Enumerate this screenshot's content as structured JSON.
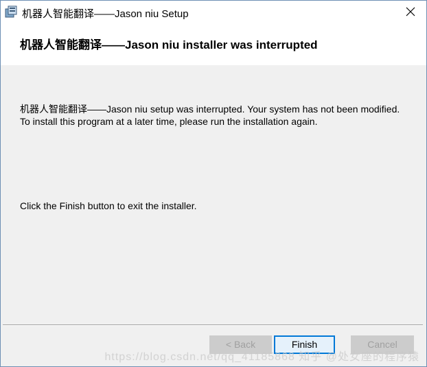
{
  "window": {
    "title": "机器人智能翻译——Jason niu Setup",
    "close_label": "×"
  },
  "header": {
    "heading": "机器人智能翻译——Jason niu installer was interrupted"
  },
  "body": {
    "message": "机器人智能翻译——Jason niu setup was interrupted. Your system has not been modified. To install this program at a later time, please run the installation again.",
    "instruction": "Click the Finish button to exit the installer."
  },
  "buttons": {
    "back_label": "< Back",
    "finish_label": "Finish",
    "cancel_label": "Cancel"
  },
  "watermark": {
    "text": "https://blog.csdn.net/qq_41185868  知乎 @处女座的程序猿"
  },
  "colors": {
    "accent": "#0078d7",
    "disabled": "#cccccc",
    "panel": "#f0f0f0"
  }
}
